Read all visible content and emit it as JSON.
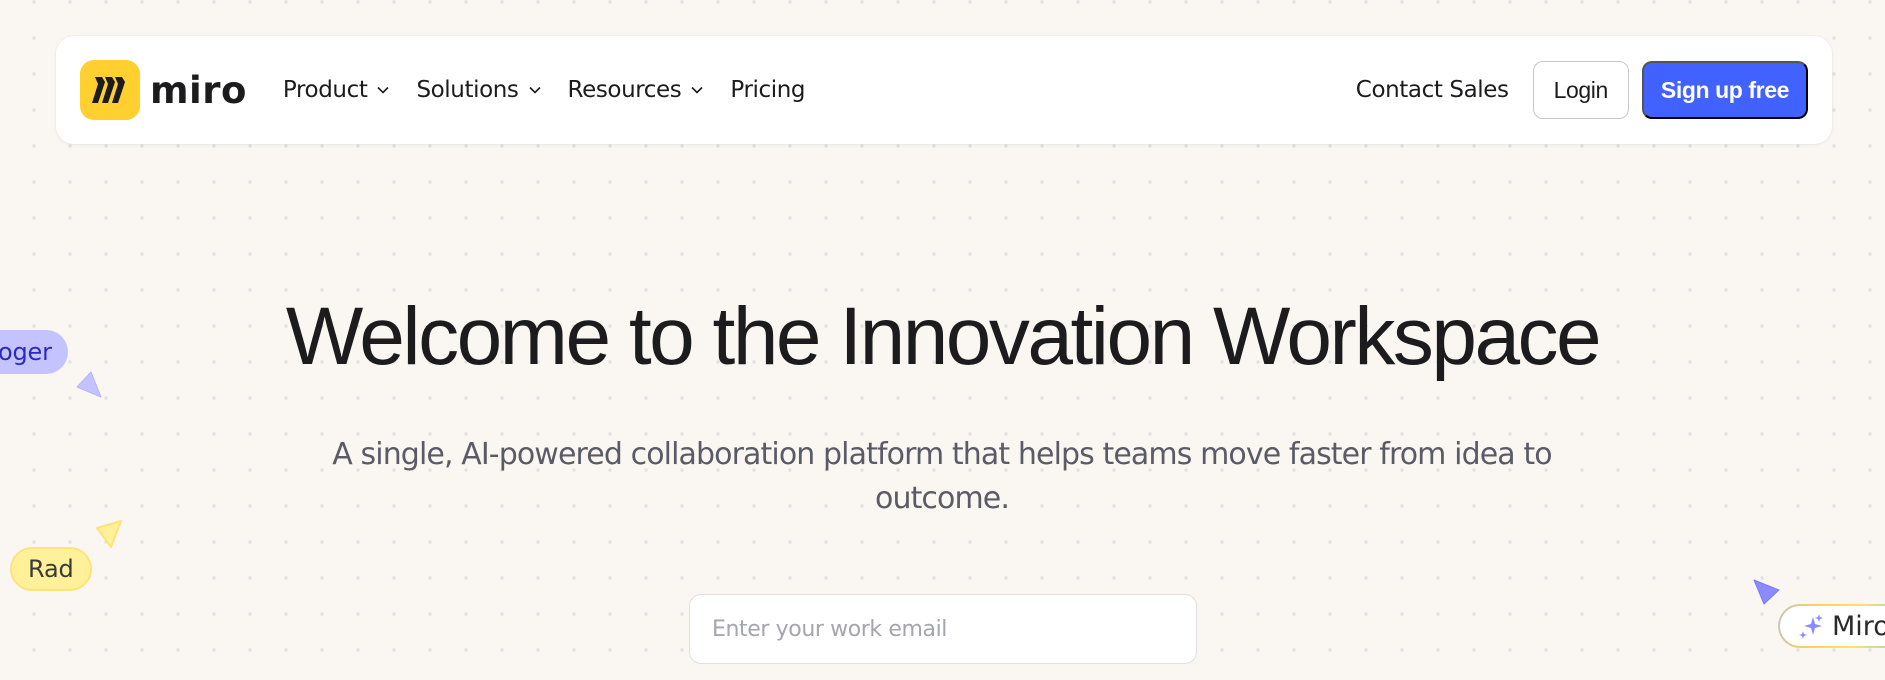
{
  "brand": {
    "name": "miro",
    "logo_color": "#ffd02f",
    "accent_color": "#4262ff"
  },
  "nav": {
    "menu": [
      {
        "label": "Product",
        "has_dropdown": true
      },
      {
        "label": "Solutions",
        "has_dropdown": true
      },
      {
        "label": "Resources",
        "has_dropdown": true
      },
      {
        "label": "Pricing",
        "has_dropdown": false
      }
    ],
    "contact_sales": "Contact Sales",
    "login": "Login",
    "signup": "Sign up free"
  },
  "hero": {
    "title": "Welcome to the Innovation Workspace",
    "subtitle": "A single, AI-powered collaboration platform that helps teams move faster from idea to outcome.",
    "email_placeholder": "Enter your work email"
  },
  "cursors": [
    {
      "name": "Roger",
      "visible_text": "oger",
      "color": "#c5c3ff",
      "icon": "cursor-arrow-icon"
    },
    {
      "name": "Rad",
      "visible_text": "Rad",
      "color": "#fff09a",
      "icon": "cursor-arrow-icon"
    },
    {
      "name": "Miro AI",
      "visible_text": "Miro",
      "color": "#8b8bff",
      "icon": "sparkle-icon"
    }
  ]
}
